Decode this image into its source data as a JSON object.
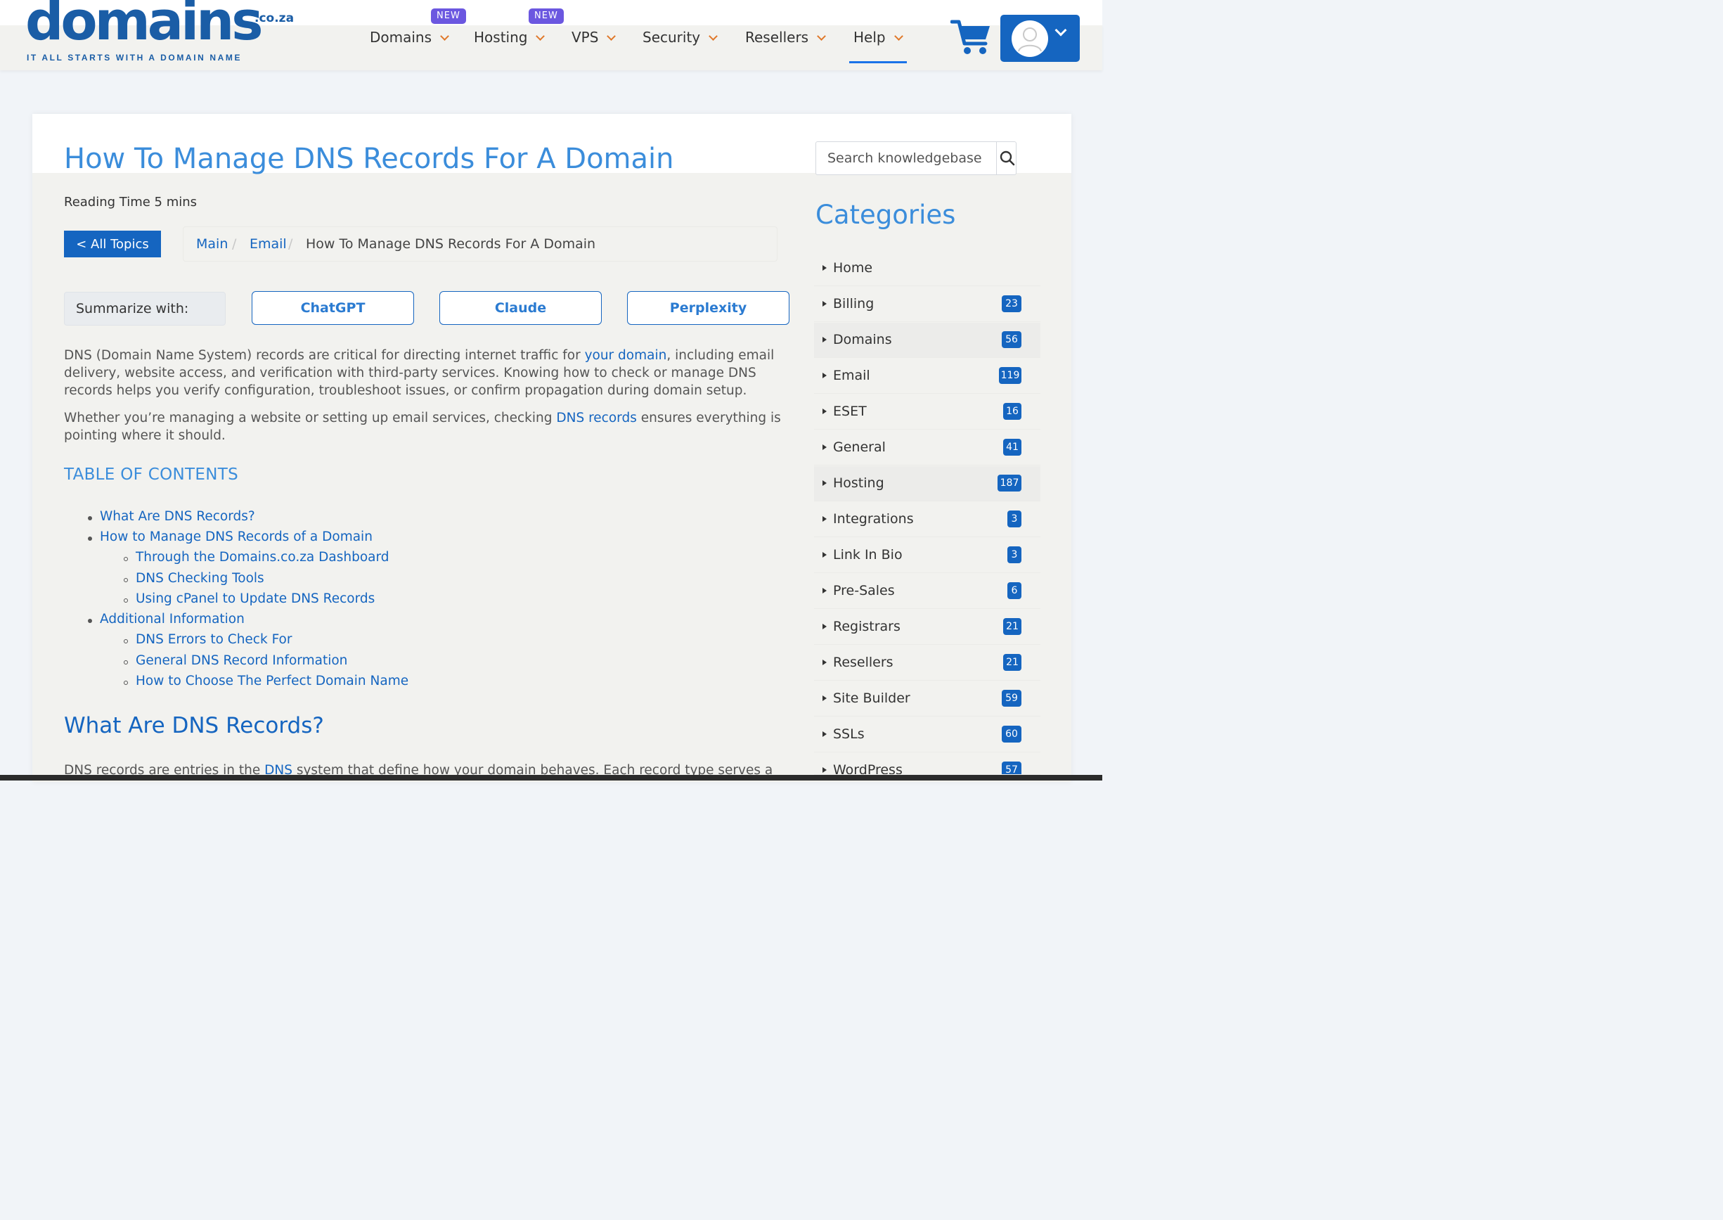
{
  "header": {
    "logo": {
      "word": "domains",
      "tld": ".co.za",
      "tagline": "IT ALL STARTS WITH A DOMAIN NAME"
    },
    "nav": [
      {
        "label": "Domains",
        "badge": "NEW"
      },
      {
        "label": "Hosting",
        "badge": "NEW"
      },
      {
        "label": "VPS"
      },
      {
        "label": "Security"
      },
      {
        "label": "Resellers"
      },
      {
        "label": "Help",
        "active": true
      }
    ],
    "icons": [
      "cart-icon",
      "user-avatar-icon",
      "chevron-down-icon"
    ]
  },
  "article": {
    "title": "How To Manage DNS Records For A Domain",
    "reading_time": "Reading Time 5 mins",
    "all_topics_label": "< All Topics",
    "breadcrumb": {
      "main": "Main",
      "email": "Email",
      "current": "How To Manage DNS Records For A Domain",
      "separator": "/"
    },
    "summarize": {
      "label": "Summarize with:",
      "buttons": [
        "ChatGPT",
        "Claude",
        "Perplexity"
      ]
    },
    "intro": {
      "p1_before": "DNS (Domain Name System) records are critical for directing internet traffic for ",
      "p1_link": "your domain",
      "p1_after": ", including email delivery, website access, and verification with third-party services. Knowing how to check or manage DNS records helps you verify configuration, troubleshoot issues, or confirm propagation during domain setup.",
      "p2_before": "Whether you’re managing a website or setting up email services, checking ",
      "p2_link": "DNS records",
      "p2_after": " ensures everything is pointing where it should."
    },
    "toc": {
      "title": "TABLE OF CONTENTS",
      "items": [
        "What Are DNS Records?",
        "How to Manage DNS Records of a Domain",
        "Through the Domains.co.za Dashboard",
        "DNS Checking Tools",
        "Using cPanel to Update DNS Records",
        "Additional Information",
        "DNS Errors to Check For",
        "General DNS Record Information",
        "How to Choose The Perfect Domain Name"
      ]
    },
    "section_heading": "What Are DNS Records?",
    "section_p_before": "DNS records are entries in the ",
    "section_p_link": "DNS",
    "section_p_after": " system that define how your domain behaves. Each record type serves a"
  },
  "sidebar": {
    "search_placeholder": "Search knowledgebase",
    "categories_title": "Categories",
    "categories": [
      {
        "label": "Home",
        "count": ""
      },
      {
        "label": "Billing",
        "count": "23"
      },
      {
        "label": "Domains",
        "count": "56"
      },
      {
        "label": "Email",
        "count": "119"
      },
      {
        "label": "ESET",
        "count": "16"
      },
      {
        "label": "General",
        "count": "41"
      },
      {
        "label": "Hosting",
        "count": "187"
      },
      {
        "label": "Integrations",
        "count": "3"
      },
      {
        "label": "Link In Bio",
        "count": "3"
      },
      {
        "label": "Pre-Sales",
        "count": "6"
      },
      {
        "label": "Registrars",
        "count": "21"
      },
      {
        "label": "Resellers",
        "count": "21"
      },
      {
        "label": "Site Builder",
        "count": "59"
      },
      {
        "label": "SSLs",
        "count": "60"
      },
      {
        "label": "WordPress",
        "count": "57"
      }
    ]
  },
  "colors": {
    "brand_blue": "#1565c0",
    "heading_blue": "#3b8ddb",
    "badge_purple": "#6b57e0",
    "chevron_orange": "#e0782a"
  }
}
